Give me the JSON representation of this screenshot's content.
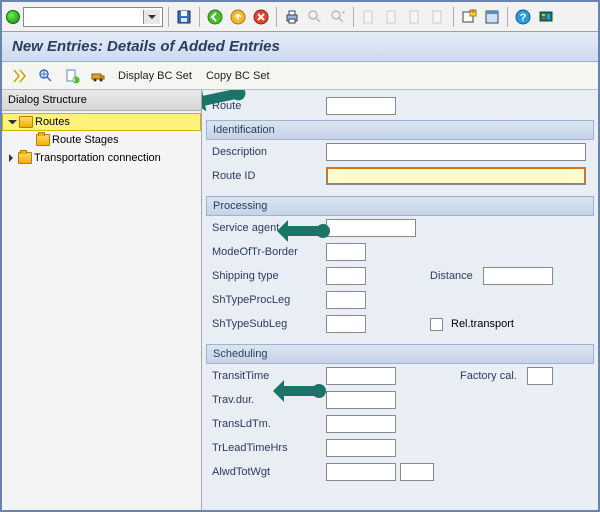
{
  "title": "New Entries: Details of Added Entries",
  "subtoolbar": {
    "display_bc": "Display BC Set",
    "copy_bc": "Copy BC Set"
  },
  "sidebar": {
    "header": "Dialog Structure",
    "items": [
      {
        "label": "Routes"
      },
      {
        "label": "Route Stages"
      },
      {
        "label": "Transportation connection"
      }
    ]
  },
  "top": {
    "route_label": "Route",
    "route_value": ""
  },
  "identification": {
    "header": "Identification",
    "description_label": "Description",
    "description_value": "",
    "routeid_label": "Route ID",
    "routeid_value": ""
  },
  "processing": {
    "header": "Processing",
    "service_agent_label": "Service agent",
    "service_agent_value": "",
    "mode_border_label": "ModeOfTr-Border",
    "mode_border_value": "",
    "shipping_type_label": "Shipping type",
    "shipping_type_value": "",
    "distance_label": "Distance",
    "distance_value": "",
    "shtype_proc_label": "ShTypeProcLeg",
    "shtype_proc_value": "",
    "shtype_subs_label": "ShTypeSubLeg",
    "shtype_subs_value": "",
    "rel_transport_label": "Rel.transport"
  },
  "scheduling": {
    "header": "Scheduling",
    "transit_time_label": "TransitTime",
    "transit_time_value": "",
    "factory_cal_label": "Factory cal.",
    "factory_cal_value": "",
    "trav_dur_label": "Trav.dur.",
    "trav_dur_value": "",
    "trans_ld_label": "TransLdTm.",
    "trans_ld_value": "",
    "tr_lead_hrs_label": "TrLeadTimeHrs",
    "tr_lead_hrs_value": "",
    "alwd_tot_wgt_label": "AlwdTotWgt",
    "alwd_tot_wgt_value": "",
    "alwd_tot_wgt_unit": ""
  }
}
